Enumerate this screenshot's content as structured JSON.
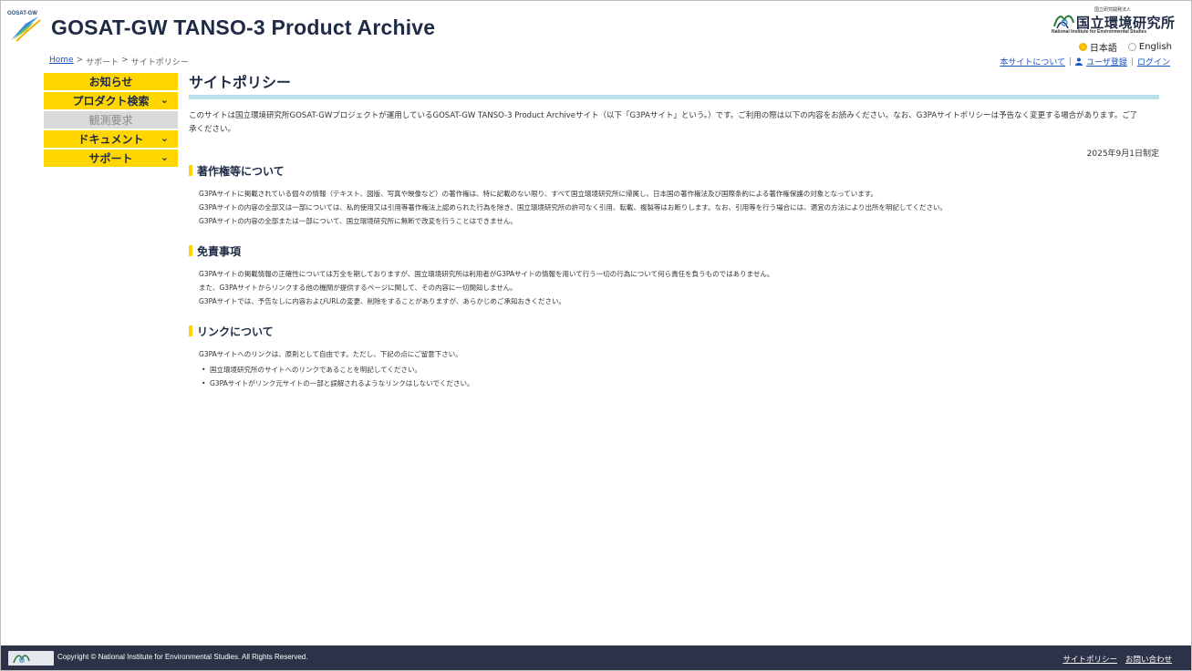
{
  "header": {
    "logo_tag": "GOSAT-GW",
    "site_title": "GOSAT-GW TANSO-3 Product Archive",
    "org_small": "国立研究開発法人",
    "org_name": "国立環境研究所",
    "org_name_en": "National Institute for Environmental Studies",
    "languages": [
      {
        "label": "日本語",
        "selected": true
      },
      {
        "label": "English",
        "selected": false
      }
    ]
  },
  "breadcrumb": {
    "home": "Home",
    "sep": ">",
    "level1": "サポート",
    "level2": "サイトポリシー"
  },
  "top_links": {
    "about": "本サイトについて",
    "sep": "|",
    "register": "ユーザ登録",
    "login": "ログイン"
  },
  "sidebar": {
    "items": [
      {
        "label": "お知らせ",
        "chevron": false,
        "disabled": false
      },
      {
        "label": "プロダクト検索",
        "chevron": true,
        "disabled": false
      },
      {
        "label": "観測要求",
        "chevron": false,
        "disabled": true
      },
      {
        "label": "ドキュメント",
        "chevron": true,
        "disabled": false
      },
      {
        "label": "サポート",
        "chevron": true,
        "disabled": false
      }
    ]
  },
  "main": {
    "title": "サイトポリシー",
    "intro_line1": "このサイトは国立環境研究所GOSAT-GWプロジェクトが運用しているGOSAT-GW TANSO-3 Product Archiveサイト（以下「G3PAサイト」という。）です。ご利用の際は以下の内容をお読みください。なお、G3PAサイトポリシーは予告なく変更する場合があります。ご了",
    "intro_line2": "承ください。",
    "date": "2025年9月1日制定",
    "sections": [
      {
        "heading": "著作権等について",
        "lines": [
          "G3PAサイトに掲載されている個々の情報（テキスト、図版、写真や映像など）の著作権は、特に記載のない限り、すべて国立環境研究所に帰属し、日本国の著作権法及び国際条約による著作権保護の対象となっています。",
          "G3PAサイトの内容の全部又は一部については、私的使用又は引用等著作権法上認められた行為を除き、国立環境研究所の許可なく引用、転載、複製等はお断りします。なお、引用等を行う場合には、適宜の方法により出所を明記してください。",
          "G3PAサイトの内容の全部または一部について、国立環境研究所に無断で改変を行うことはできません。"
        ]
      },
      {
        "heading": "免責事項",
        "lines": [
          "G3PAサイトの掲載情報の正確性については万全を期しておりますが、国立環境研究所は利用者がG3PAサイトの情報を用いて行う一切の行為について何ら責任を負うものではありません。",
          "また、G3PAサイトからリンクする他の機関が提供するページに関して、その内容に一切関知しません。",
          "G3PAサイトでは、予告なしに内容およびURLの変更、削除をすることがありますが、あらかじめご承知おきください。"
        ]
      },
      {
        "heading": "リンクについて",
        "lines": [
          "G3PAサイトへのリンクは、原則として自由です。ただし、下記の点にご留意下さい。"
        ],
        "bullets": [
          "国立環境研究所のサイトへのリンクであることを明記してください。",
          "G3PAサイトがリンク元サイトの一部と誤解されるようなリンクはしないでください。"
        ]
      }
    ]
  },
  "footer": {
    "copyright": "Copyright © National Institute for Environmental Studies. All Rights Reserved.",
    "links": [
      "サイトポリシー",
      "お問い合わせ"
    ]
  },
  "colors": {
    "accent_yellow": "#ffd600",
    "title_rule": "#b9e1e8",
    "navy": "#1f2b45",
    "footer_bg": "#2c3248",
    "link_blue": "#1a53c5",
    "disabled_gray": "#d9d9d9"
  },
  "icons": {
    "site_logo": "gosat-gw-satellite-logo",
    "org_logo": "nies-logo",
    "chevron": "chevron-down-icon",
    "user": "user-icon"
  }
}
